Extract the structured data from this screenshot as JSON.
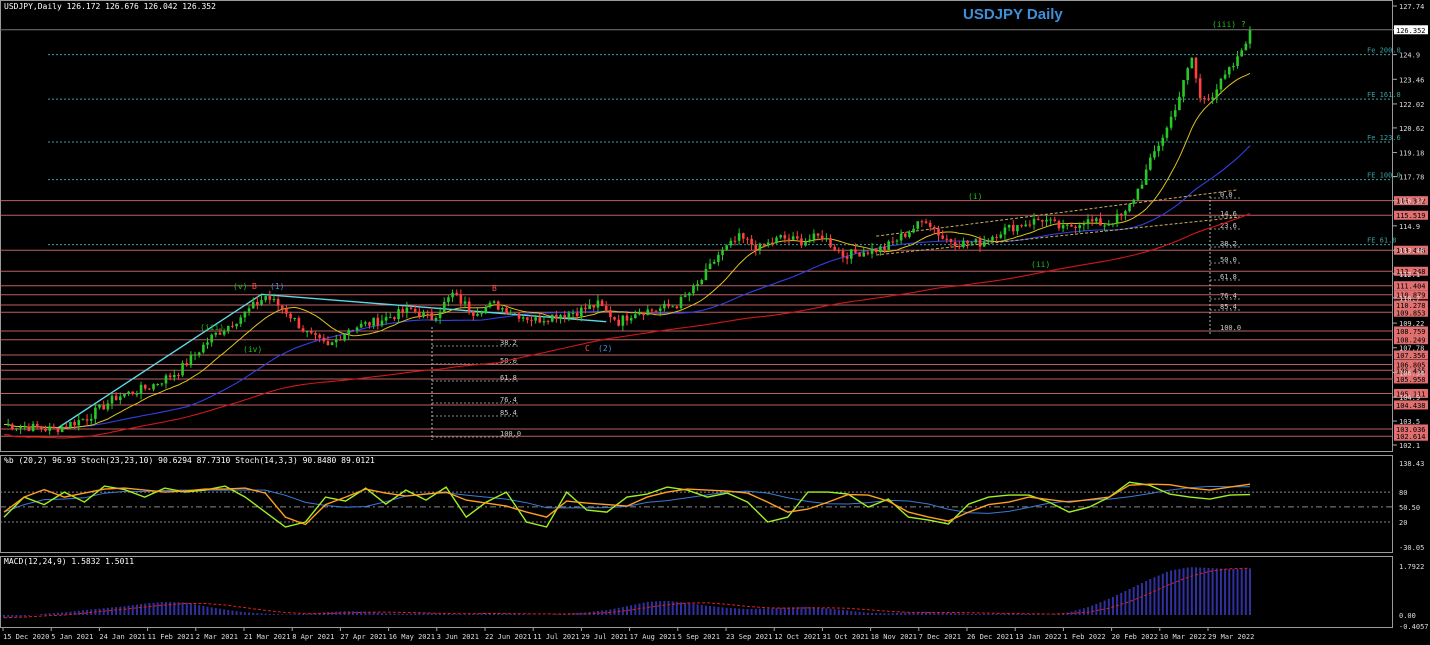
{
  "title": "USDJPY Daily",
  "header": {
    "main": "USDJPY,Daily  126.172 126.676 126.042 126.352",
    "osc": "%b (20,2) 96.93  Stoch(23,23,10) 90.6294 87.7310  Stoch(14,3,3) 90.8480 89.0121",
    "macd": "MACD(12,24,9) 1.5832 1.5011"
  },
  "colors": {
    "background": "#000000",
    "bull": "#28c828",
    "bear": "#ff4040",
    "level_box": "#e07070",
    "fib_line": "#3aa0a0",
    "trend_line": "#5ed8e8",
    "sma_long": "#d01818",
    "sma_mid": "#3040e0",
    "sma_fast": "#e0c020",
    "stoch_main": "#ffa020",
    "pct_b": "#a0f020",
    "osc_blue": "#3a7ad8",
    "macd_hist": "#3030a0",
    "macd_signal": "#e02020",
    "title": "#3f8fd8"
  },
  "chart_data": {
    "type": "candlestick",
    "title": "USDJPY Daily",
    "ylim": [
      102.1,
      127.74
    ],
    "y_ticks": [
      127.74,
      126.352,
      124.9,
      123.46,
      122.02,
      120.62,
      119.18,
      117.78,
      116.372,
      114.9,
      113.476,
      112.1,
      110.7,
      109.22,
      107.78,
      106.34,
      104.9,
      103.5,
      102.1
    ],
    "price_marker": 126.352,
    "x_labels": [
      "15 Dec 2020",
      "5 Jan 2021",
      "24 Jan 2021",
      "11 Feb 2021",
      "2 Mar 2021",
      "21 Mar 2021",
      "8 Apr 2021",
      "27 Apr 2021",
      "16 May 2021",
      "3 Jun 2021",
      "22 Jun 2021",
      "11 Jul 2021",
      "29 Jul 2021",
      "17 Aug 2021",
      "5 Sep 2021",
      "23 Sep 2021",
      "12 Oct 2021",
      "31 Oct 2021",
      "18 Nov 2021",
      "7 Dec 2021",
      "26 Dec 2021",
      "13 Jan 2022",
      "1 Feb 2022",
      "20 Feb 2022",
      "10 Mar 2022",
      "29 Mar 2022"
    ],
    "price_path": [
      [
        0,
        103.3
      ],
      [
        12,
        103.0
      ],
      [
        20,
        103.7
      ],
      [
        27,
        104.9
      ],
      [
        35,
        105.5
      ],
      [
        42,
        106.4
      ],
      [
        50,
        108.4
      ],
      [
        57,
        109.6
      ],
      [
        63,
        110.8
      ],
      [
        68,
        109.9
      ],
      [
        73,
        108.6
      ],
      [
        78,
        107.8
      ],
      [
        83,
        108.9
      ],
      [
        88,
        109.2
      ],
      [
        93,
        109.6
      ],
      [
        98,
        110.0
      ],
      [
        103,
        109.5
      ],
      [
        108,
        110.9
      ],
      [
        113,
        109.9
      ],
      [
        118,
        110.3
      ],
      [
        123,
        109.8
      ],
      [
        128,
        109.4
      ],
      [
        133,
        109.7
      ],
      [
        138,
        109.9
      ],
      [
        143,
        110.3
      ],
      [
        148,
        109.3
      ],
      [
        152,
        109.9
      ],
      [
        157,
        110.0
      ],
      [
        162,
        110.3
      ],
      [
        167,
        111.4
      ],
      [
        172,
        113.2
      ],
      [
        177,
        114.2
      ],
      [
        182,
        113.6
      ],
      [
        187,
        114.2
      ],
      [
        192,
        114.0
      ],
      [
        197,
        114.3
      ],
      [
        202,
        113.2
      ],
      [
        207,
        113.4
      ],
      [
        212,
        113.6
      ],
      [
        218,
        114.6
      ],
      [
        222,
        115.3
      ],
      [
        226,
        114.2
      ],
      [
        230,
        113.9
      ],
      [
        235,
        113.9
      ],
      [
        240,
        114.6
      ],
      [
        245,
        115.0
      ],
      [
        250,
        115.3
      ],
      [
        255,
        114.7
      ],
      [
        260,
        115.2
      ],
      [
        265,
        115.0
      ],
      [
        270,
        115.6
      ],
      [
        274,
        117.5
      ],
      [
        277,
        119.2
      ],
      [
        280,
        120.6
      ],
      [
        283,
        122.5
      ],
      [
        286,
        124.7
      ],
      [
        288,
        122.3
      ],
      [
        291,
        122.6
      ],
      [
        294,
        123.6
      ],
      [
        297,
        124.6
      ],
      [
        300,
        126.35
      ]
    ],
    "levels": [
      116.372,
      115.519,
      113.476,
      112.248,
      111.404,
      110.879,
      110.278,
      109.853,
      108.759,
      108.249,
      107.356,
      106.805,
      106.465,
      105.958,
      105.111,
      104.438,
      103.036,
      102.614
    ],
    "fib_lines": [
      {
        "label": "Fe 200.0",
        "value": 124.9
      },
      {
        "label": "FE 161.8",
        "value": 122.3
      },
      {
        "label": "Fe 123.6",
        "value": 119.8
      },
      {
        "label": "FE 100.0",
        "value": 117.6
      },
      {
        "label": "FE 61.8",
        "value": 113.8
      }
    ],
    "retracement_1": [
      "38.2",
      "50.0",
      "61.8",
      "76.4",
      "85.4",
      "100.0"
    ],
    "retracement_2": [
      "0.0",
      "14.6",
      "23.6",
      "38.2",
      "50.0",
      "61.8",
      "76.4",
      "85.4",
      "100.0"
    ],
    "wave_labels": [
      "(v)",
      "B",
      "(1)",
      "(iii)",
      "(iv)",
      "B",
      "C",
      "(2)",
      "(i)",
      "(ii)",
      "(iii) ?"
    ],
    "oscillator": {
      "ylim": [
        -30.05,
        138.43
      ],
      "y_ticks": [
        "138.43",
        "80",
        "50.50",
        "20",
        "-30.05"
      ],
      "stoch_main": [
        40,
        70,
        85,
        70,
        78,
        86,
        88,
        84,
        80,
        82,
        86,
        86,
        88,
        78,
        30,
        15,
        55,
        70,
        86,
        78,
        72,
        76,
        80,
        64,
        58,
        52,
        40,
        30,
        62,
        58,
        55,
        52,
        70,
        80,
        86,
        84,
        82,
        78,
        60,
        40,
        46,
        60,
        75,
        74,
        62,
        40,
        30,
        22,
        40,
        55,
        60,
        70,
        65,
        60,
        65,
        70,
        94,
        96,
        95,
        88,
        84,
        90,
        96
      ],
      "pct_b": [
        30,
        70,
        55,
        80,
        60,
        92,
        85,
        70,
        88,
        80,
        84,
        92,
        70,
        40,
        10,
        20,
        70,
        62,
        88,
        56,
        84,
        64,
        90,
        30,
        60,
        80,
        20,
        10,
        80,
        44,
        40,
        70,
        76,
        90,
        84,
        70,
        78,
        60,
        20,
        30,
        80,
        80,
        76,
        50,
        66,
        30,
        24,
        16,
        56,
        70,
        74,
        74,
        60,
        40,
        50,
        70,
        100,
        94,
        76,
        70,
        66,
        74,
        75
      ]
    },
    "macd": {
      "y_ticks": [
        "1.7922",
        "0.00",
        "-0.4057"
      ],
      "histogram": [
        -0.1,
        -0.05,
        0.05,
        0.1,
        0.18,
        0.25,
        0.32,
        0.42,
        0.48,
        0.46,
        0.32,
        0.2,
        0.1,
        0.05,
        0.02,
        0.04,
        0.1,
        0.14,
        0.12,
        0.06,
        0.04,
        0.08,
        0.04,
        0.02,
        0.08,
        0.06,
        0.02,
        0.0,
        0.06,
        0.1,
        0.18,
        0.32,
        0.48,
        0.52,
        0.44,
        0.34,
        0.26,
        0.22,
        0.24,
        0.28,
        0.3,
        0.24,
        0.16,
        0.08,
        0.06,
        0.1,
        0.12,
        0.08,
        0.04,
        0.04,
        0.06,
        0.04,
        0.0,
        0.1,
        0.3,
        0.6,
        0.95,
        1.3,
        1.62,
        1.75,
        1.72,
        1.68,
        1.7
      ]
    }
  }
}
